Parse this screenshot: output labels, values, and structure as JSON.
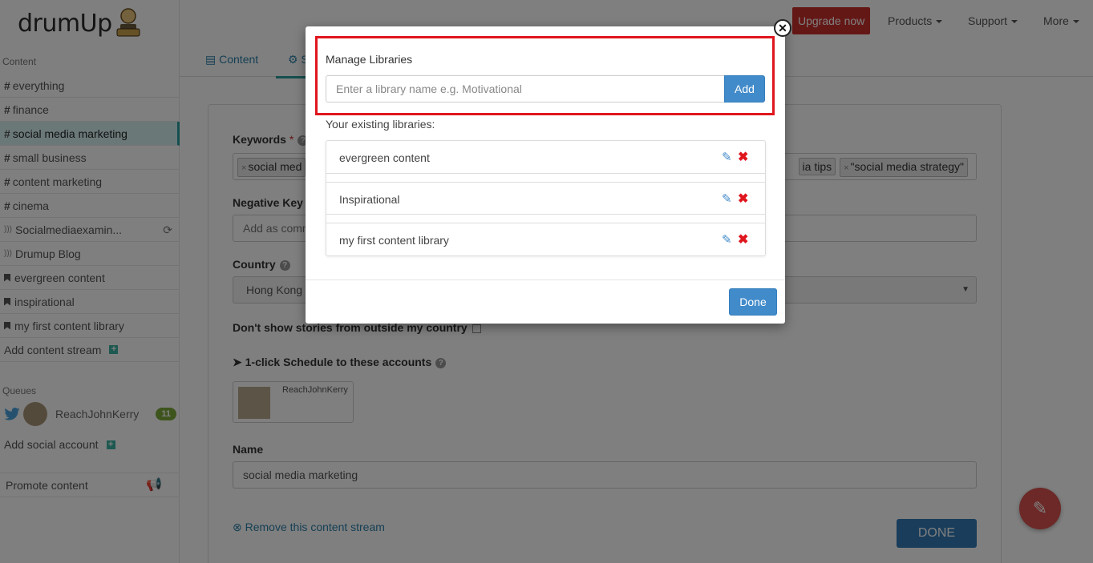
{
  "logo": {
    "text": "drumUp"
  },
  "sidebar": {
    "content_heading": "Content",
    "streams": [
      {
        "label": "everything",
        "type": "hashtag"
      },
      {
        "label": "finance",
        "type": "hashtag"
      },
      {
        "label": "social media marketing",
        "type": "hashtag",
        "active": true
      },
      {
        "label": "small business",
        "type": "hashtag"
      },
      {
        "label": "content marketing",
        "type": "hashtag"
      },
      {
        "label": "cinema",
        "type": "hashtag"
      },
      {
        "label": "Socialmediaexamin...",
        "type": "rss"
      },
      {
        "label": "Drumup Blog",
        "type": "rss"
      },
      {
        "label": "evergreen content",
        "type": "library"
      },
      {
        "label": "inspirational",
        "type": "library"
      },
      {
        "label": "my first content library",
        "type": "library"
      }
    ],
    "add_stream": "Add content stream",
    "queues_heading": "Queues",
    "queue": {
      "name": "ReachJohnKerry",
      "count": "11"
    },
    "add_account": "Add social account",
    "promote": "Promote content"
  },
  "topnav": {
    "upgrade": "Upgrade now",
    "products": "Products",
    "support": "Support",
    "more": "More"
  },
  "tabs": {
    "content": "Content",
    "settings": "S"
  },
  "form": {
    "keywords_label": "Keywords",
    "keyword_tags_left": [
      "social med"
    ],
    "keyword_tags_right": [
      "ia tips",
      "\"social media strategy\""
    ],
    "negative_label": "Negative Key",
    "negative_placeholder": "Add as comm",
    "country_label": "Country",
    "country_value": "Hong Kong",
    "outside_label": "Don't show stories from outside my country",
    "schedule_label": "1-click Schedule to these accounts",
    "account_name": "ReachJohnKerry",
    "name_label": "Name",
    "name_value": "social media marketing",
    "remove_link": "Remove this content stream",
    "done": "DONE"
  },
  "modal": {
    "title": "Manage Libraries",
    "input_placeholder": "Enter a library name e.g. Motivational",
    "add_button": "Add",
    "existing_label": "Your existing libraries:",
    "libraries": [
      "evergreen content",
      "Inspirational",
      "my first content library"
    ],
    "done_button": "Done"
  },
  "colors": {
    "accent": "#2a9d9d",
    "primary": "#428bca",
    "danger": "#d9534f",
    "highlight": "#e0161e"
  }
}
